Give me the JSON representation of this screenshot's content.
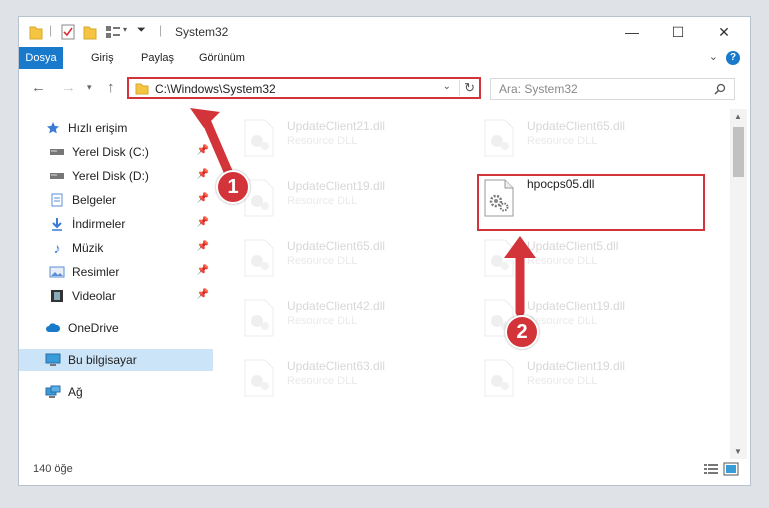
{
  "window": {
    "title": "System32",
    "minimize": "—",
    "maximize": "☐",
    "close": "✕"
  },
  "ribbon": {
    "tabs": [
      {
        "label": "Dosya",
        "active": true
      },
      {
        "label": "Giriş"
      },
      {
        "label": "Paylaş"
      },
      {
        "label": "Görünüm"
      }
    ],
    "help": "?"
  },
  "nav": {
    "address": "C:\\Windows\\System32",
    "search_placeholder": "Ara: System32"
  },
  "sidebar": {
    "items": [
      {
        "label": "Hızlı erişim",
        "icon": "star-icon"
      },
      {
        "label": "Yerel Disk (C:)",
        "icon": "drive-icon",
        "pinned": true
      },
      {
        "label": "Yerel Disk (D:)",
        "icon": "drive-icon",
        "pinned": true
      },
      {
        "label": "Belgeler",
        "icon": "documents-icon",
        "pinned": true
      },
      {
        "label": "İndirmeler",
        "icon": "download-icon",
        "pinned": true
      },
      {
        "label": "Müzik",
        "icon": "music-icon",
        "pinned": true
      },
      {
        "label": "Resimler",
        "icon": "pictures-icon",
        "pinned": true
      },
      {
        "label": "Videolar",
        "icon": "video-icon",
        "pinned": true
      },
      {
        "label": "OneDrive",
        "icon": "cloud-icon"
      },
      {
        "label": "Bu bilgisayar",
        "icon": "computer-icon",
        "selected": true
      },
      {
        "label": "Ağ",
        "icon": "network-icon"
      }
    ]
  },
  "files": [
    {
      "name": "UpdateClient21.dll",
      "desc": "Resource DLL"
    },
    {
      "name": "UpdateClient65.dll",
      "desc": "Resource DLL"
    },
    {
      "name": "UpdateClient19.dll",
      "desc": "Resource DLL"
    },
    {
      "name": "hpocps05.dll",
      "desc": ""
    },
    {
      "name": "UpdateClient65.dll",
      "desc": "Resource DLL"
    },
    {
      "name": "UpdateClient5.dll",
      "desc": "Resource DLL"
    },
    {
      "name": "UpdateClient42.dll",
      "desc": "Resource DLL"
    },
    {
      "name": "UpdateClient19.dll",
      "desc": "Resource DLL"
    },
    {
      "name": "UpdateClient63.dll",
      "desc": "Resource DLL"
    },
    {
      "name": "UpdateClient19.dll",
      "desc": "Resource DLL"
    }
  ],
  "status": {
    "count": "140 öğe"
  },
  "annotations": {
    "step1": "1",
    "step2": "2",
    "color": "#d3343a"
  }
}
